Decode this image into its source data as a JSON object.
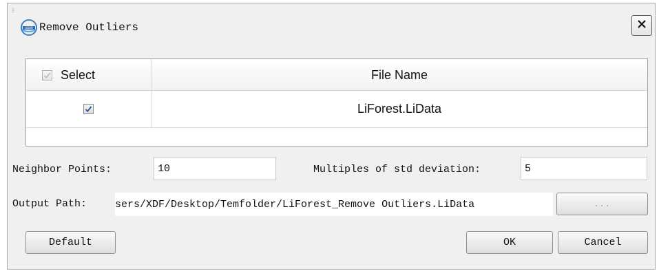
{
  "window": {
    "title": "Remove Outliers",
    "icon": "liforest-app-icon"
  },
  "table": {
    "columns": [
      "Select",
      "File Name"
    ],
    "header_select_checked": true,
    "rows": [
      {
        "checked": true,
        "file_name": "LiForest.LiData"
      }
    ]
  },
  "params": {
    "neighbor_label": "Neighbor Points:",
    "neighbor_value": "10",
    "std_label": "Multiples of std deviation:",
    "std_value": "5",
    "output_label": "Output Path:",
    "output_value": "sers/XDF/Desktop/Temfolder/LiForest_Remove Outliers.LiData",
    "browse_label": "..."
  },
  "buttons": {
    "default": "Default",
    "ok": "OK",
    "cancel": "Cancel"
  },
  "icons": {
    "close": "close-icon",
    "checkbox": "checkmark-icon"
  }
}
